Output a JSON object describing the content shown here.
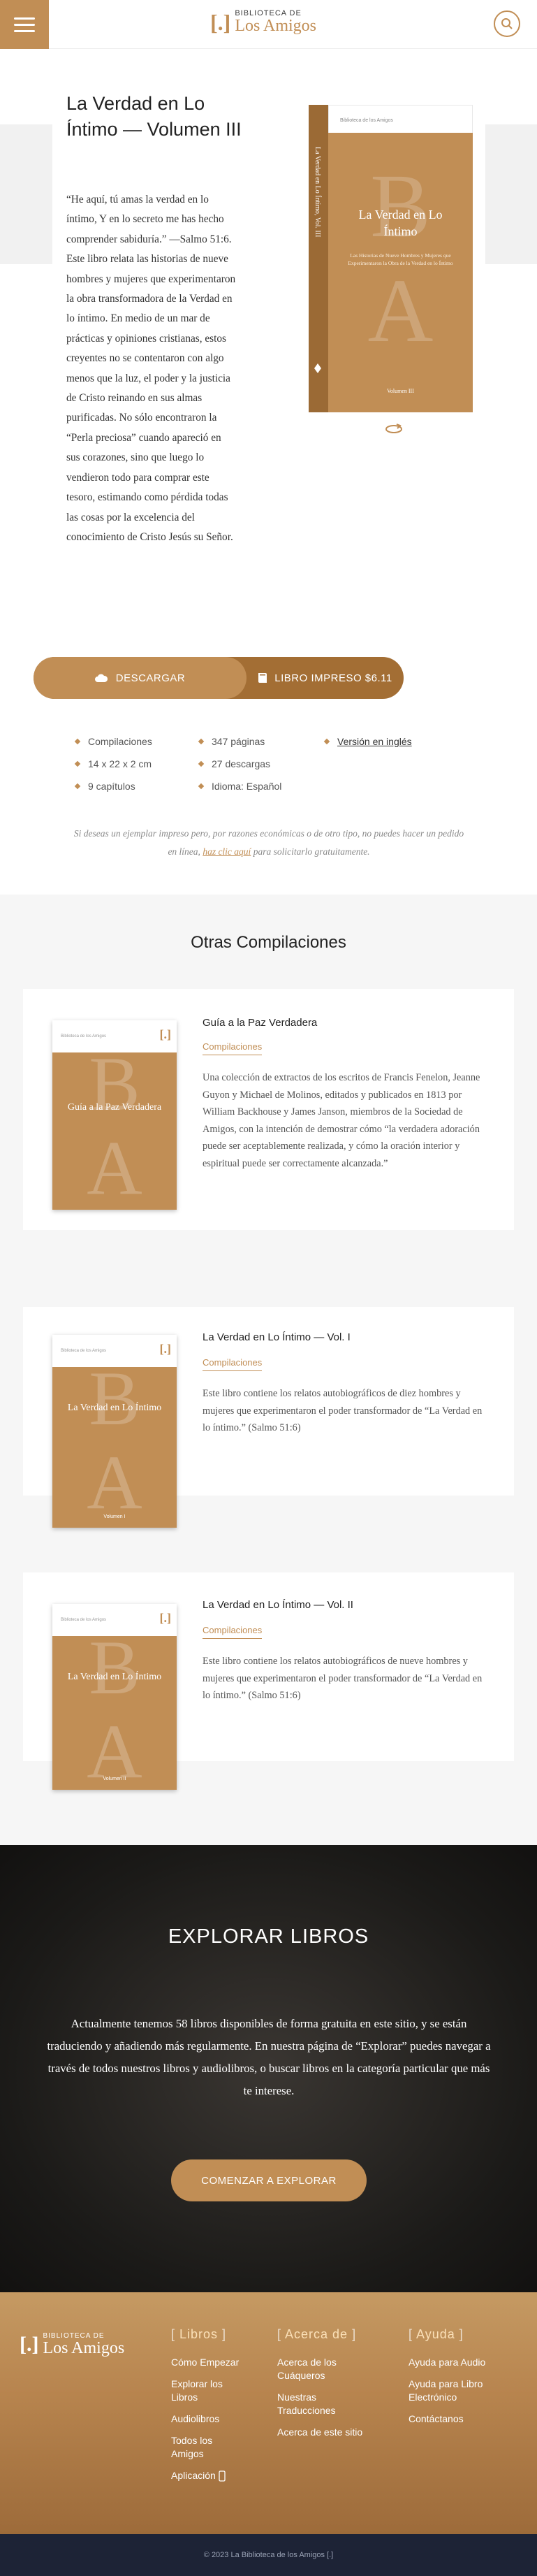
{
  "header": {
    "logo_top": "BIBLIOTECA DE",
    "logo_main": "Los Amigos",
    "logo_mark": "[.]",
    "icons": {
      "menu": "menu-icon",
      "search": "search-icon"
    }
  },
  "book": {
    "title": "La Verdad en Lo Íntimo — Volumen III",
    "description": "“He aquí, tú amas la verdad en lo íntimo, Y en lo secreto me has hecho comprender sabiduría.” —Salmo 51:6. Este libro relata las historias de nueve hombres y mujeres que experimentaron la obra transformadora de la Verdad en lo íntimo. En medio de un mar de prácticas y opiniones cristianas, estos creyentes no se contentaron con algo menos que la luz, el poder y la justicia de Cristo reinando en sus almas purificadas. No sólo encontraron la “Perla preciosa” cuando apareció en sus corazones, sino que luego lo vendieron todo para comprar este tesoro, estimando como pérdida todas las cosas por la excelencia del conocimiento de Cristo Jesús su Señor.",
    "cover": {
      "spine_text": "La Verdad en Lo Íntimo, Vol. III",
      "top_text": "Biblioteca de los Amigos",
      "title": "La Verdad en Lo Íntimo",
      "subtitle": "Las Historias de Nueve Hombres y Mujeres que Experimentaron la Obra de la Verdad en lo Íntimo",
      "volume": "Volumen III"
    },
    "download_label": "DESCARGAR",
    "print_label": "LIBRO IMPRESO $6.11",
    "facts_col1": [
      "Compilaciones",
      "14 x 22 x 2 cm",
      "9 capítulos"
    ],
    "facts_col2": [
      "347 páginas",
      "27 descargas",
      "Idioma: Español"
    ],
    "english_link": "Versión en inglés",
    "note_before": "Si deseas un ejemplar impreso pero, por razones económicas o de otro tipo, no puedes hacer un pedido en línea, ",
    "note_link": "haz clic aquí",
    "note_after": " para solicitarlo gratuitamente."
  },
  "others": {
    "title": "Otras Compilaciones",
    "items": [
      {
        "title": "Guía a la Paz Verdadera",
        "category": "Compilaciones",
        "cover_title": "Guía a la Paz Verdadera",
        "cover_small": "Biblioteca de los Amigos",
        "description": "Una colección de extractos de los escritos de Francis Fenelon, Jeanne Guyon y Michael de Molinos, editados y publicados en 1813 por William Backhouse y James Janson, miembros de la Sociedad de Amigos, con la intención de demostrar cómo “la verdadera adoración puede ser aceptablemente realizada, y cómo la oración interior y espiritual puede ser correctamente alcanzada.”"
      },
      {
        "title": "La Verdad en Lo Íntimo — Vol. I",
        "category": "Compilaciones",
        "cover_title": "La Verdad en Lo Íntimo",
        "cover_small": "Biblioteca de los Amigos",
        "cover_volume": "Volumen I",
        "description": "Este libro contiene los relatos autobiográficos de diez hombres y mujeres que experimentaron el poder transformador de “La Verdad en lo íntimo.” (Salmo 51:6)"
      },
      {
        "title": "La Verdad en Lo Íntimo — Vol. II",
        "category": "Compilaciones",
        "cover_title": "La Verdad en Lo Íntimo",
        "cover_small": "Biblioteca de los Amigos",
        "cover_volume": "Volumen II",
        "description": "Este libro contiene los relatos autobiográficos de nueve hombres y mujeres que experimentaron el poder transformador de “La Verdad en lo íntimo.” (Salmo 51:6)"
      }
    ]
  },
  "explore": {
    "title": "EXPLORAR LIBROS",
    "text": "Actualmente tenemos 58 libros disponibles de forma gratuita en este sitio, y se están traduciendo y añadiendo más regularmente. En nuestra página de “Explorar” puedes navegar a través de todos nuestros libros y audiolibros, o buscar libros en la categoría particular que más te interese.",
    "button": "COMENZAR A EXPLORAR"
  },
  "footer": {
    "logo_top": "BIBLIOTECA DE",
    "logo_main": "Los Amigos",
    "col1": {
      "title": "Libros",
      "links": [
        "Cómo Empezar",
        "Explorar los Libros",
        "Audiolibros",
        "Todos los Amigos",
        "Aplicación"
      ]
    },
    "col2": {
      "title": "Acerca de",
      "links": [
        "Acerca de los Cuáqueros",
        "Nuestras Traducciones",
        "Acerca de este sitio"
      ]
    },
    "col3": {
      "title": "Ayuda",
      "links": [
        "Ayuda para Audio",
        "Ayuda para Libro Electrónico",
        "Contáctanos"
      ]
    },
    "copyright": "© 2023 La Biblioteca de los Amigos [.]"
  },
  "colors": {
    "accent": "#c18e55",
    "dark": "#1d2336"
  }
}
